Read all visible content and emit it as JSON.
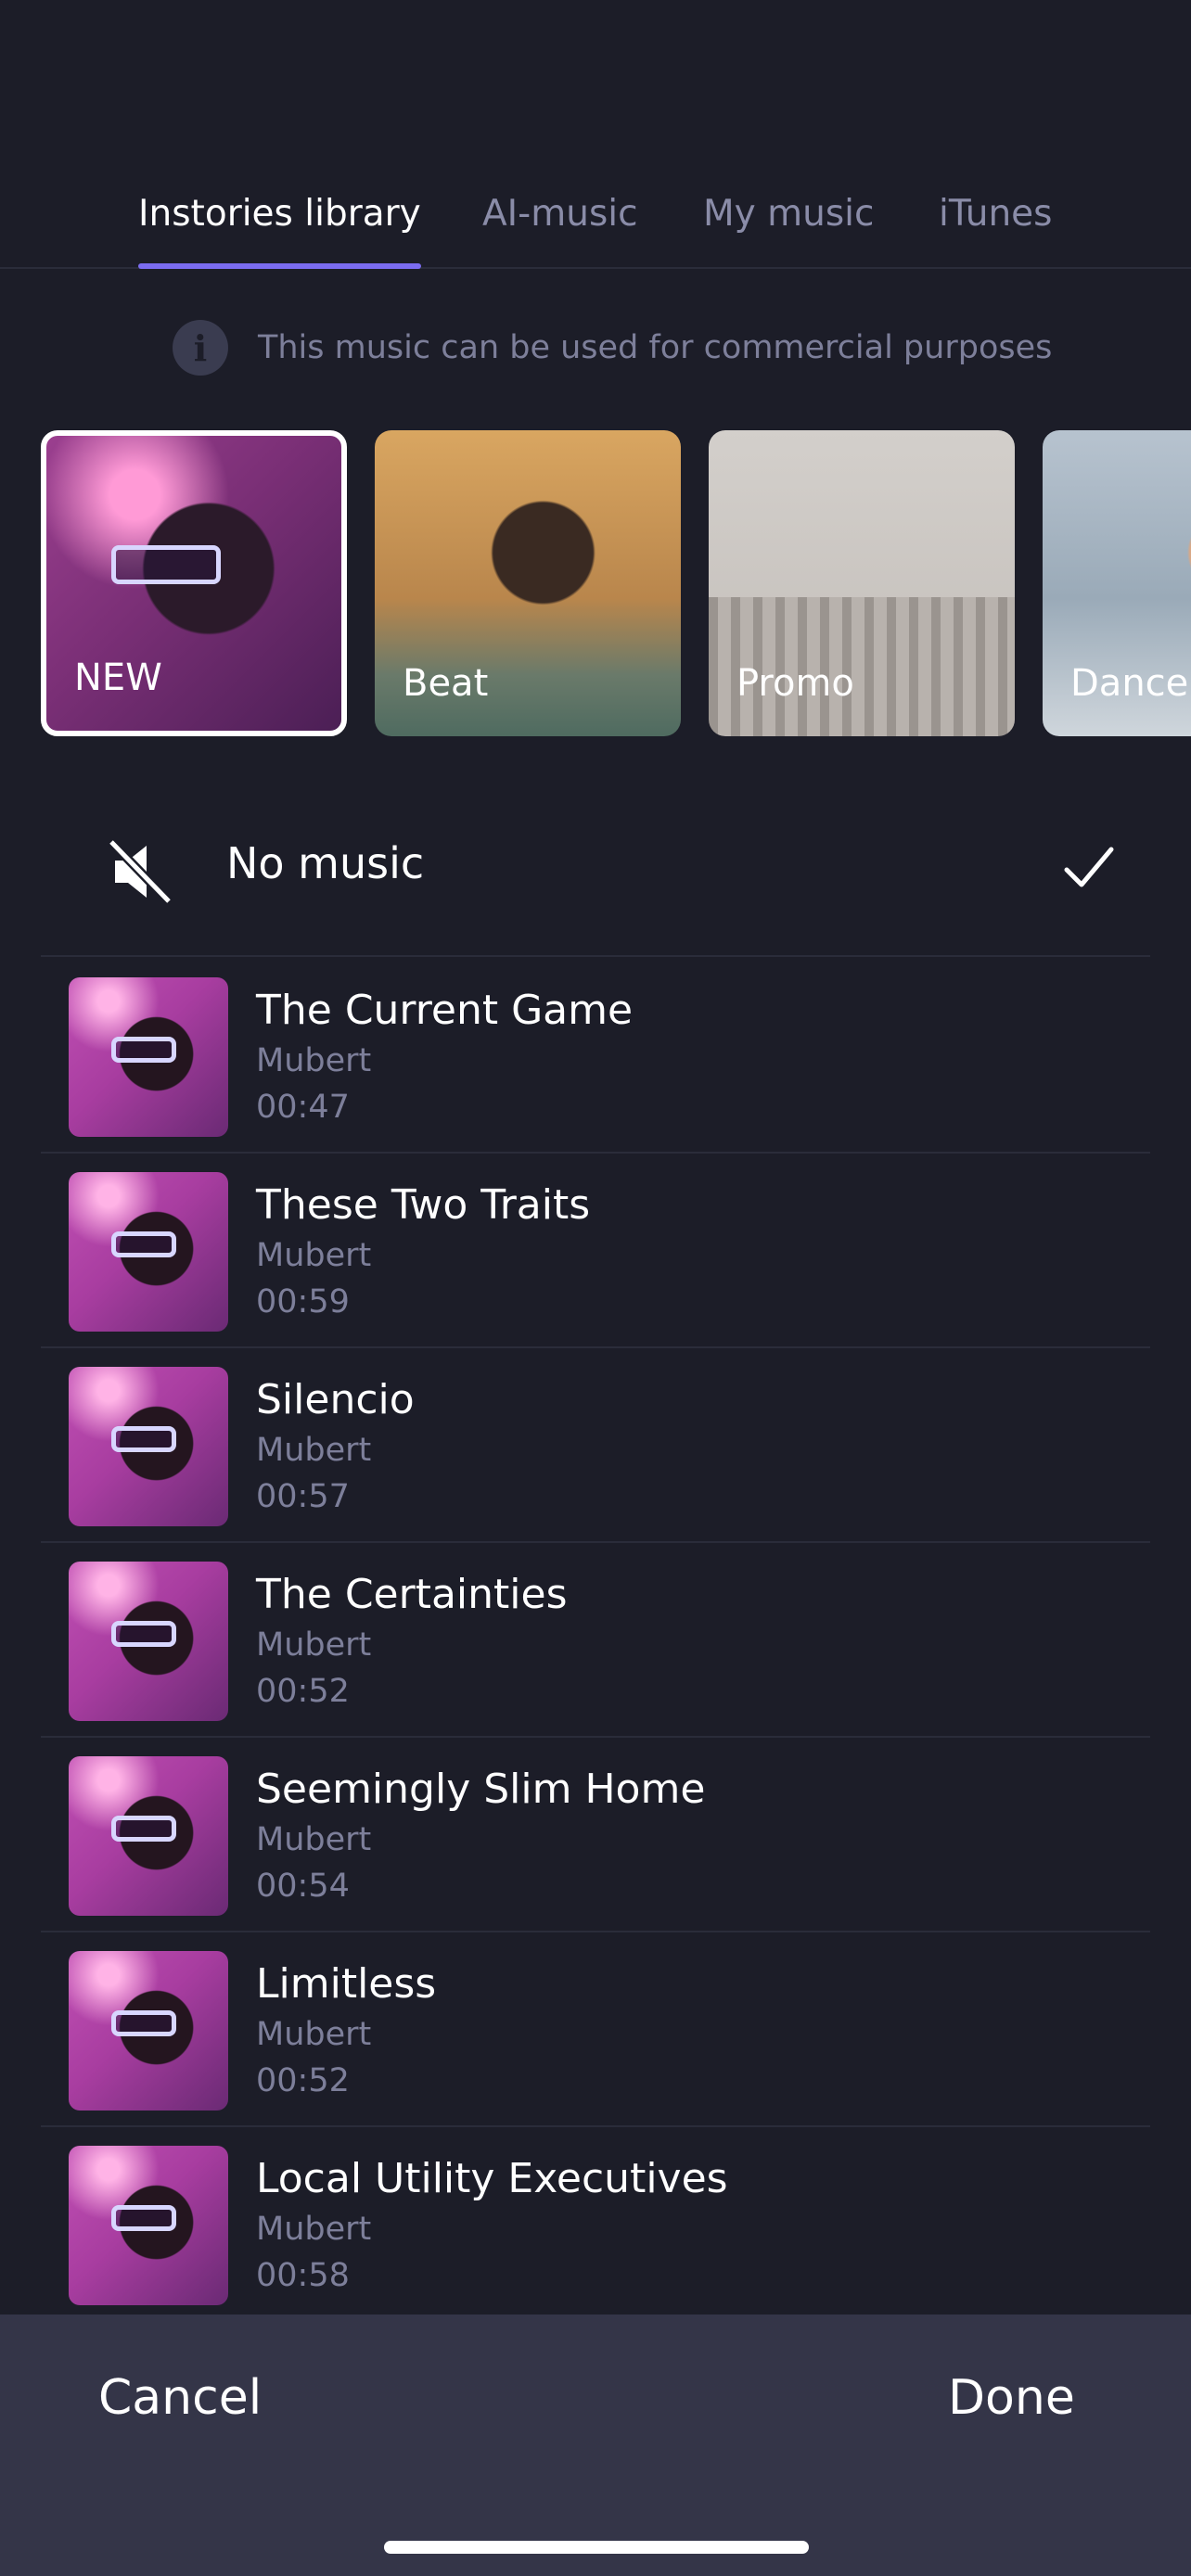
{
  "tabs": [
    {
      "label": "Instories library",
      "active": true
    },
    {
      "label": "AI-music",
      "active": false
    },
    {
      "label": "My music",
      "active": false
    },
    {
      "label": "iTunes",
      "active": false
    }
  ],
  "notice": {
    "icon": "info-icon",
    "text": "This music can be used for commercial purposes"
  },
  "categories": [
    {
      "label": "NEW",
      "selected": true
    },
    {
      "label": "Beat",
      "selected": false
    },
    {
      "label": "Promo",
      "selected": false
    },
    {
      "label": "Dance",
      "selected": false
    }
  ],
  "no_music": {
    "label": "No music",
    "icon": "mute-icon",
    "selected_icon": "checkmark-icon",
    "selected": true
  },
  "tracks": [
    {
      "title": "The Current Game",
      "artist": "Mubert",
      "duration": "00:47"
    },
    {
      "title": "These Two Traits",
      "artist": "Mubert",
      "duration": "00:59"
    },
    {
      "title": "Silencio",
      "artist": "Mubert",
      "duration": "00:57"
    },
    {
      "title": "The Certainties",
      "artist": "Mubert",
      "duration": "00:52"
    },
    {
      "title": "Seemingly Slim Home",
      "artist": "Mubert",
      "duration": "00:54"
    },
    {
      "title": "Limitless",
      "artist": "Mubert",
      "duration": "00:52"
    },
    {
      "title": "Local Utility Executives",
      "artist": "Mubert",
      "duration": "00:58"
    }
  ],
  "footer": {
    "cancel_label": "Cancel",
    "done_label": "Done"
  },
  "colors": {
    "background": "#1c1d28",
    "accent": "#7b6cf0",
    "muted_text": "#7d7f9a",
    "footer": "#343548"
  }
}
